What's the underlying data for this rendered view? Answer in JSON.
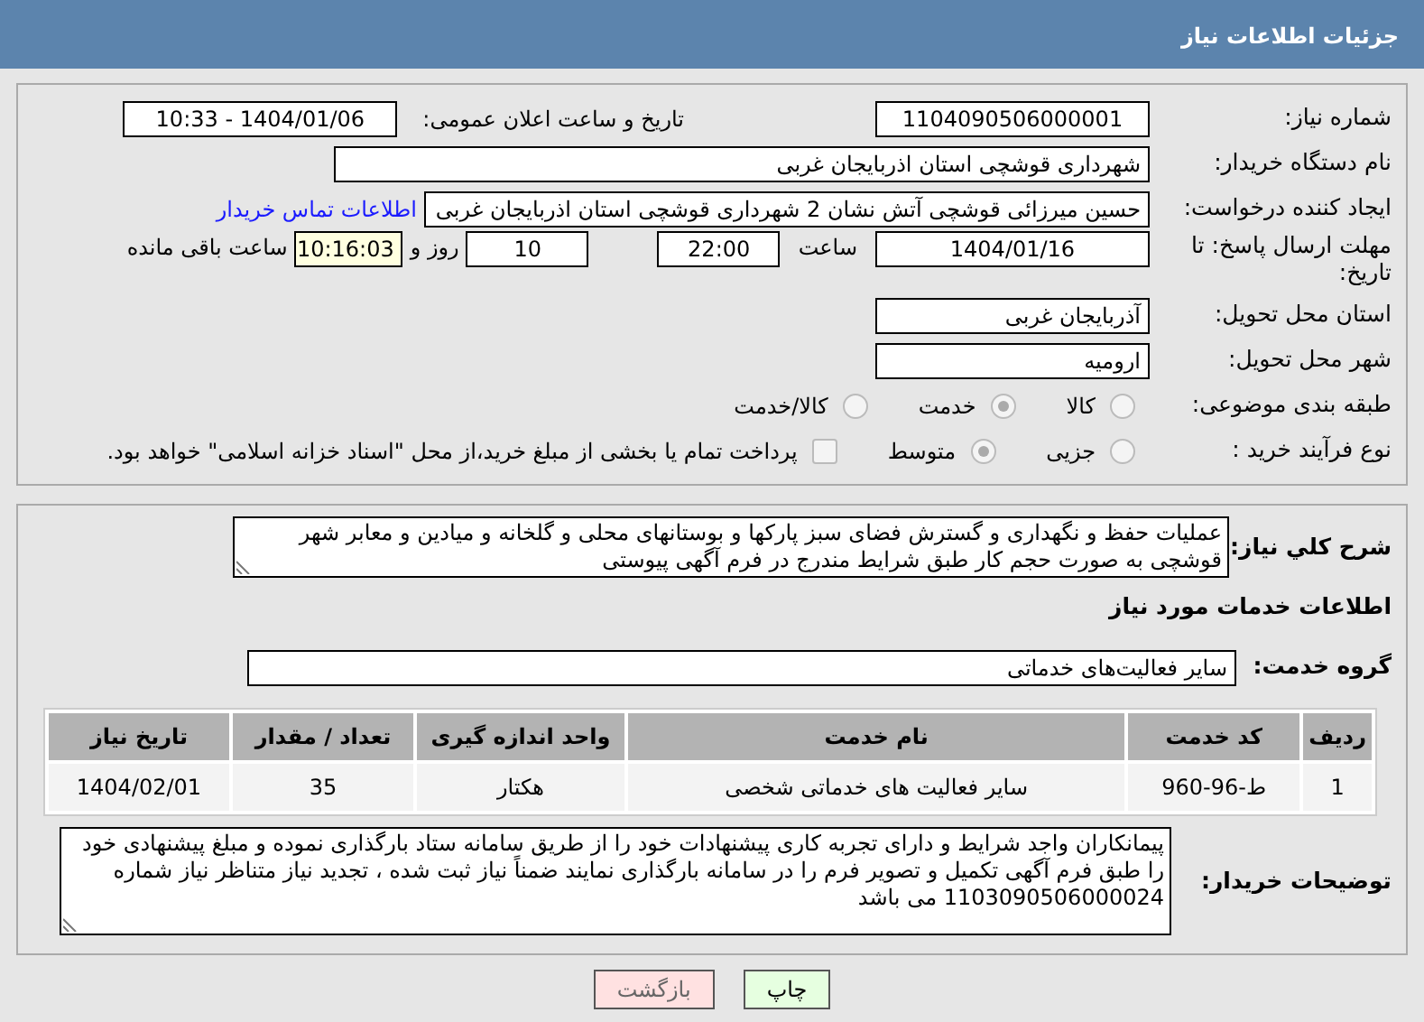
{
  "header": {
    "title": "جزئیات اطلاعات نیاز"
  },
  "need_number": {
    "label": "شماره نیاز:",
    "value": "1104090506000001"
  },
  "announce": {
    "label": "تاریخ و ساعت اعلان عمومی:",
    "value": "1404/01/06 - 10:33"
  },
  "buyer_org": {
    "label": "نام دستگاه خریدار:",
    "value": "شهرداری قوشچی استان اذربایجان غربی"
  },
  "requester": {
    "label": "ایجاد کننده درخواست:",
    "value": "حسین میرزائی قوشچی آتش نشان 2 شهرداری قوشچی استان اذربایجان غربی",
    "link": "اطلاعات تماس خریدار"
  },
  "deadline": {
    "label": "مهلت ارسال پاسخ: تا تاریخ:",
    "date": "1404/01/16",
    "time_label": "ساعت",
    "time": "22:00",
    "days": "10",
    "days_label": "روز و",
    "remaining": "10:16:03",
    "remaining_label": "ساعت باقی مانده"
  },
  "province": {
    "label": "استان محل تحویل:",
    "value": "آذربایجان غربی"
  },
  "city": {
    "label": "شهر محل تحویل:",
    "value": "ارومیه"
  },
  "category": {
    "label": "طبقه بندی موضوعی:",
    "options": [
      {
        "label": "کالا",
        "selected": false
      },
      {
        "label": "خدمت",
        "selected": true
      },
      {
        "label": "کالا/خدمت",
        "selected": false
      }
    ]
  },
  "purchase_type": {
    "label": "نوع فرآیند خرید :",
    "options": [
      {
        "label": "جزیی",
        "selected": false
      },
      {
        "label": "متوسط",
        "selected": true
      }
    ],
    "payment": {
      "label": "پرداخت تمام یا بخشی از مبلغ خرید،از محل \"اسناد خزانه اسلامی\" خواهد بود.",
      "checked": false
    }
  },
  "description": {
    "label": "شرح کلي نياز:",
    "value": "عملیات حفظ و نگهداری و گسترش فضای سبز پارکها و بوستانهای محلی و گلخانه و میادین و معابر شهر قوشچی به صورت حجم کار طبق شرایط مندرج در فرم آگهی پیوستی"
  },
  "services_title": "اطلاعات خدمات مورد نیاز",
  "service_group": {
    "label": "گروه خدمت:",
    "value": "سایر فعالیت‌های خدماتی"
  },
  "table": {
    "columns": [
      "ردیف",
      "کد خدمت",
      "نام خدمت",
      "واحد اندازه گیری",
      "تعداد / مقدار",
      "تاریخ نیاز"
    ],
    "rows": [
      [
        "1",
        "ط-96-960",
        "سایر فعالیت های خدماتی شخصی",
        "هکتار",
        "35",
        "1404/02/01"
      ]
    ]
  },
  "buyer_notes": {
    "label": "توضیحات خریدار:",
    "value": "پیمانکاران واجد شرایط و دارای تجربه کاری پیشنهادات خود را از طریق سامانه ستاد بارگذاری نموده و مبلغ پیشنهادی خود را طبق فرم آگهی تکمیل و تصویر فرم را در سامانه بارگذاری نمایند ضمناً نیاز ثبت شده ، تجدید نیاز متناظر نیاز شماره 1103090506000024 می باشد"
  },
  "buttons": [
    {
      "label": "چاپ",
      "kind": "print"
    },
    {
      "label": "بازگشت",
      "kind": "back"
    }
  ]
}
